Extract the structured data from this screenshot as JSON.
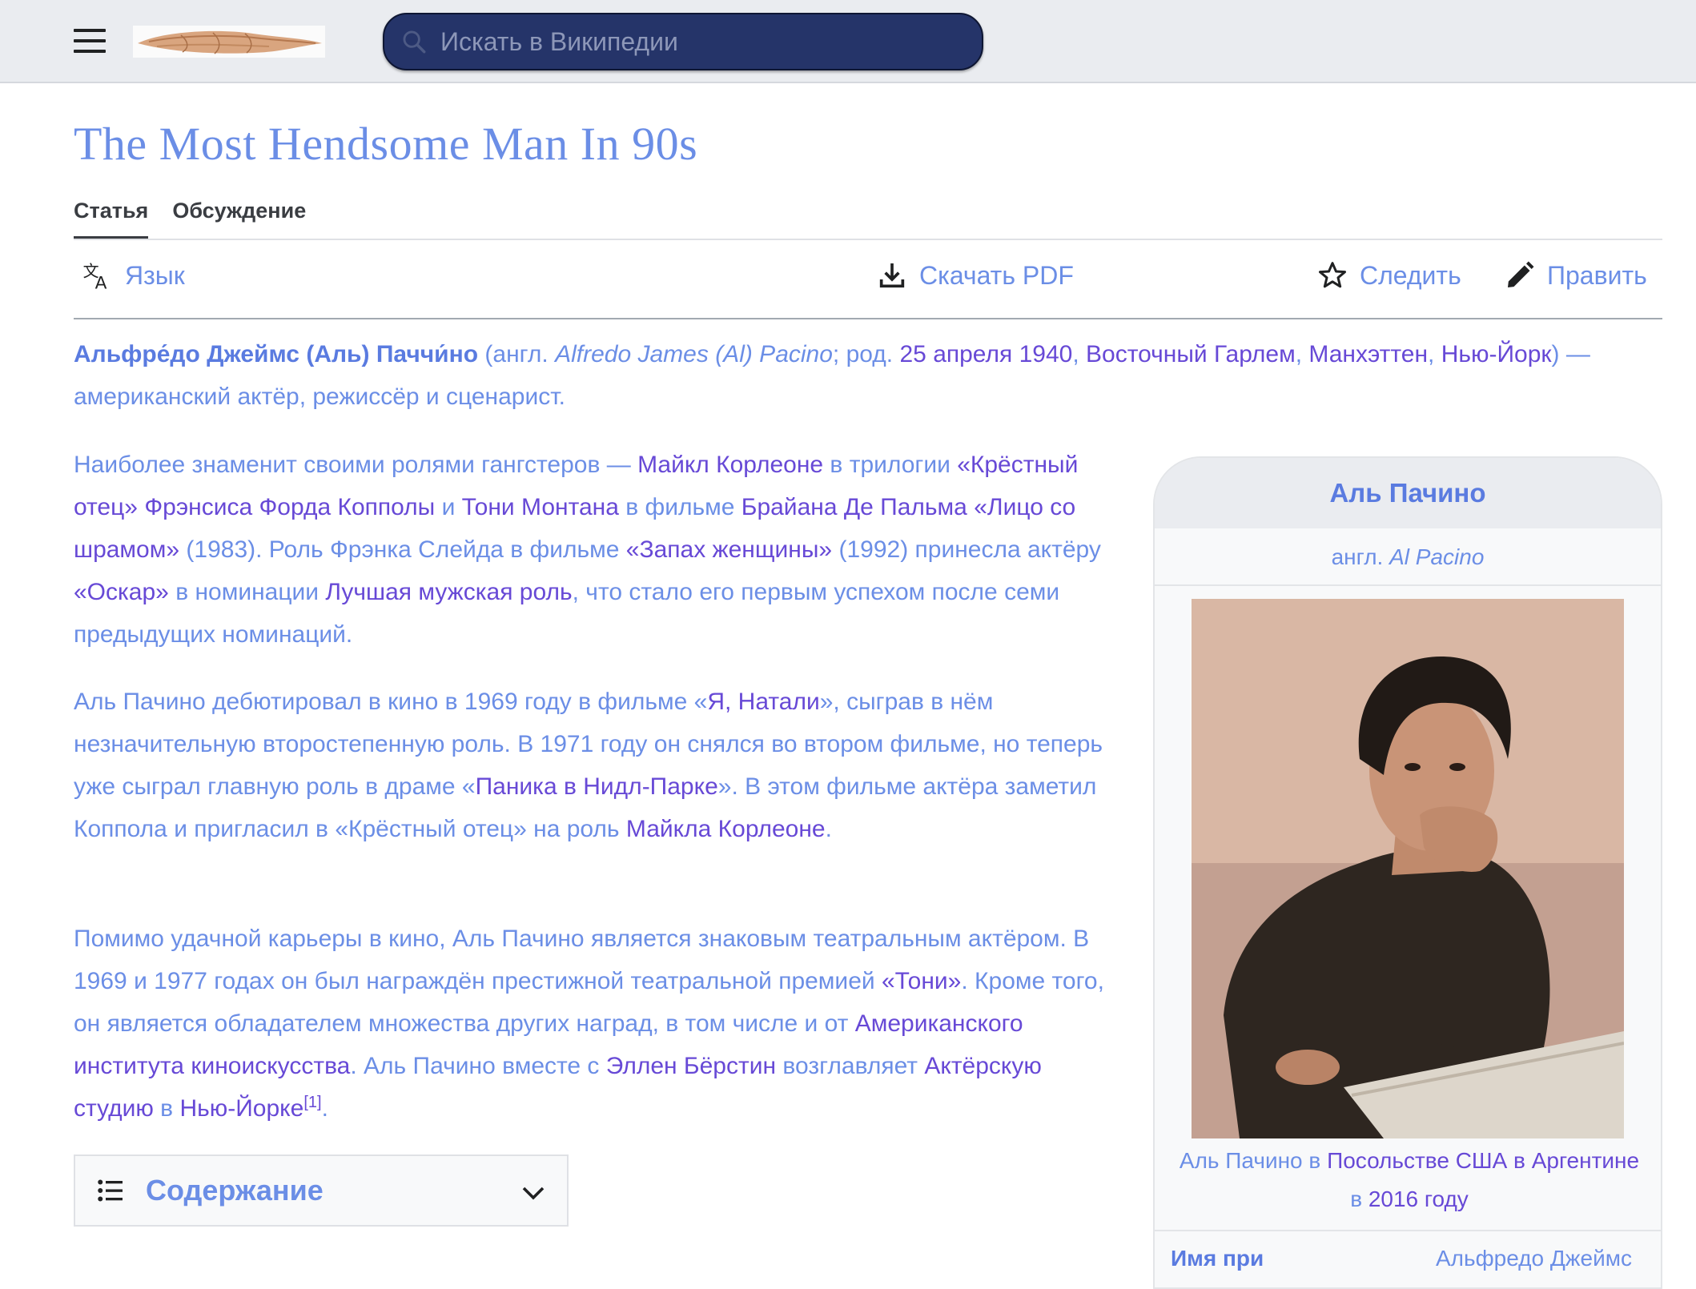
{
  "header": {
    "menu_icon": "hamburger-menu-icon",
    "logo": "site-logo",
    "search_placeholder": "Искать в Википедии"
  },
  "article": {
    "title": "The Most Hendsome Man In 90s",
    "tabs": [
      {
        "label": "Статья",
        "active": true
      },
      {
        "label": "Обсуждение",
        "active": false
      }
    ],
    "toolbar": {
      "language": "Язык",
      "download": "Скачать PDF",
      "watch": "Следить",
      "edit": "Править"
    },
    "lead": {
      "name": "Альфре́до Джеймс",
      "nick": "(Аль)",
      "surname": "Паччи́но",
      "open": " (англ. ",
      "english": "Alfredo James (Al) Pacino",
      "born": "; род. ",
      "birthdate": "25 апреля",
      "year": "1940",
      "place1": "Восточный Гарлем",
      "place2": "Манхэттен",
      "place3": "Нью-Йорк",
      "rest": ") — американский актёр, режиссёр и сценарист."
    },
    "p1": {
      "t1": "Наиболее знаменит своими ролями гангстеров — ",
      "l1": "Майкл Корлеоне",
      "t2": " в трилогии ",
      "l2": "«Крёстный отец»",
      "l3": "Фрэнсиса Форда Копполы",
      "t3": " и ",
      "l4": "Тони Монтана",
      "t4": " в фильме ",
      "l5": "Брайана Де Пальма",
      "l6": "«Лицо со шрамом»",
      "t5": " (1983). Роль Фрэнка Слейда в фильме ",
      "l7": "«Запах женщины»",
      "t6": " (1992) принесла актёру ",
      "l8": "«Оскар»",
      "t7": " в номинации ",
      "l9": "Лучшая мужская роль",
      "t8": ", что стало его первым успехом после семи предыдущих номинаций."
    },
    "p2": {
      "t1": "Аль Пачино дебютировал в кино в 1969 году в фильме «",
      "l1": "Я, Натали",
      "t2": "», сыграв в нём незначительную второстепенную роль. В 1971 году он снялся во втором фильме, но теперь уже сыграл главную роль в драме «",
      "l2": "Паника в Нидл-Парке",
      "t3": "». В этом фильме актёра заметил Коппола и пригласил в «Крёстный отец» на роль ",
      "l3": "Майкла Корлеоне",
      "t4": "."
    },
    "p3": {
      "t1": "Помимо удачной карьеры в кино, Аль Пачино является знаковым театральным актёром. В 1969 и 1977 годах он был награждён престижной театральной премией ",
      "l1": "«Тони»",
      "t2": ". Кроме того, он является обладателем множества других наград, в том числе и от ",
      "l2": "Американского института киноискусства",
      "t3": ". Аль Пачино вместе с ",
      "l3": "Эллен Бёрстин",
      "t4": " возглавляет ",
      "l4": "Актёрскую студию",
      "t5": " в ",
      "l5": "Нью-Йорке",
      "ref": "[1]",
      "t6": "."
    },
    "toc_label": "Содержание"
  },
  "infobox": {
    "title": "Аль Пачино",
    "lang_prefix": "англ. ",
    "english_name": "Al Pacino",
    "caption_t1": "Аль Пачино в ",
    "caption_l1": "Посольстве США в Аргентине",
    "caption_t2": " в ",
    "caption_l2": "2016 году",
    "row_key": "Имя при",
    "row_value": "Альфредо Джеймс"
  }
}
